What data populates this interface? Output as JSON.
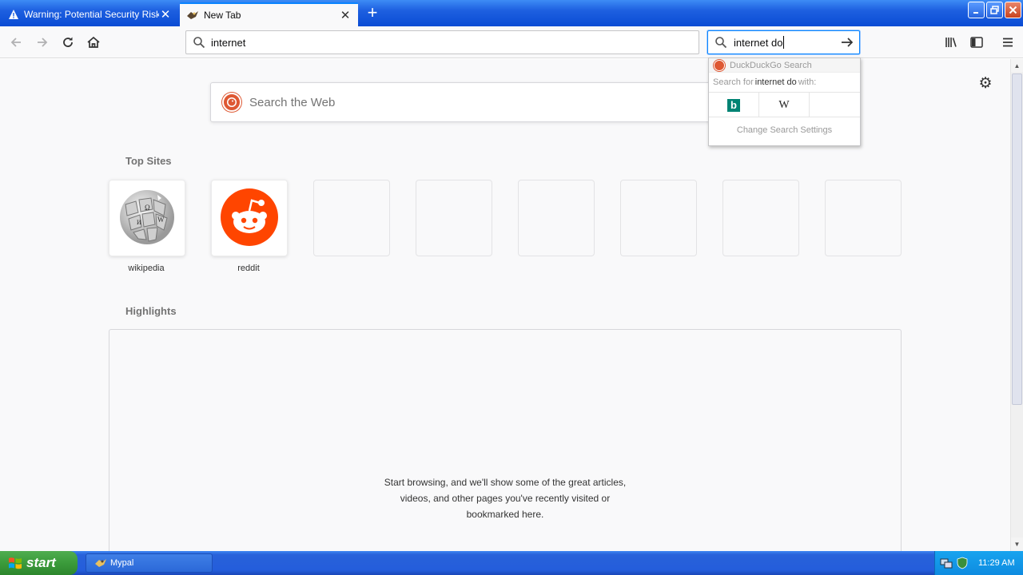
{
  "tabs": [
    {
      "title": "Warning: Potential Security Risk A",
      "icon": "warning-icon",
      "active": false
    },
    {
      "title": "New Tab",
      "icon": "mypal-icon",
      "active": true
    }
  ],
  "navbar": {
    "url_value": "internet",
    "search_value": "internet do"
  },
  "search_dropdown": {
    "engine_name": "DuckDuckGo Search",
    "search_for_prefix": "Search for",
    "search_term": "internet do",
    "search_for_suffix": "with:",
    "one_off_engines": [
      "bing-icon",
      "wikipedia-icon"
    ],
    "wiki_glyph": "W",
    "bing_glyph": "b",
    "settings_label": "Change Search Settings"
  },
  "page": {
    "search_placeholder": "Search the Web",
    "top_sites_title": "Top Sites",
    "top_sites": [
      {
        "label": "wikipedia"
      },
      {
        "label": "reddit"
      }
    ],
    "highlights_title": "Highlights",
    "highlights_message_line1": "Start browsing, and we'll show some of the great articles,",
    "highlights_message_line2": "videos, and other pages you've recently visited or",
    "highlights_message_line3": "bookmarked here."
  },
  "taskbar": {
    "start_label": "start",
    "task_label": "Mypal",
    "clock": "11:29 AM"
  },
  "colors": {
    "accent": "#0a84ff",
    "ddg": "#de5833",
    "reddit": "#ff4500",
    "bing": "#008373"
  }
}
